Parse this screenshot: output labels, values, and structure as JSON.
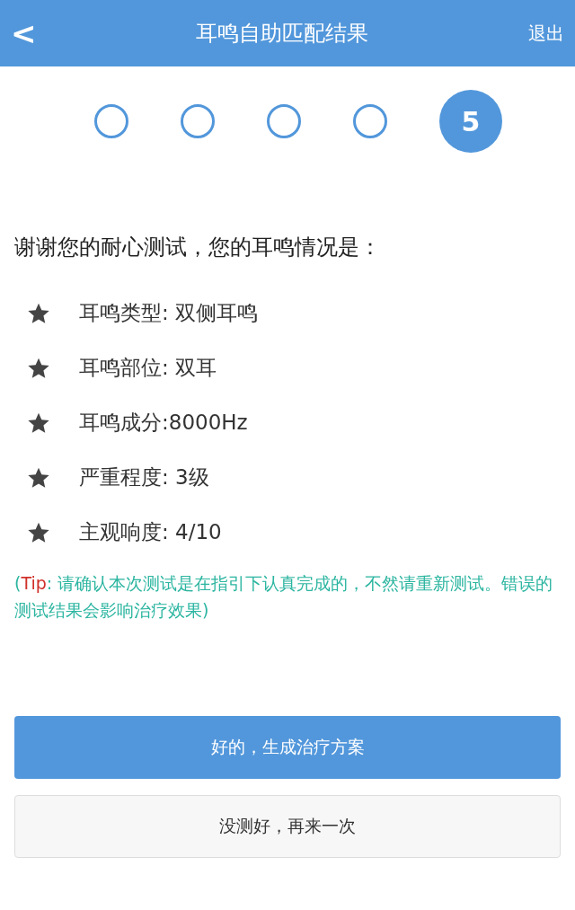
{
  "header": {
    "back": "<",
    "title": "耳鸣自助匹配结果",
    "exit": "退出"
  },
  "steps": [
    {
      "selected": false
    },
    {
      "selected": false
    },
    {
      "selected": false
    },
    {
      "selected": false
    },
    {
      "selected": true,
      "label": "5"
    }
  ],
  "intro": "谢谢您的耐心测试，您的耳鸣情况是：",
  "results": [
    "耳鸣类型: 双侧耳鸣",
    "耳鸣部位: 双耳",
    "耳鸣成分:8000Hz",
    "严重程度: 3级",
    "主观响度: 4/10"
  ],
  "tip": {
    "open": "(",
    "label": "Tip",
    "text": ": 请确认本次测试是在指引下认真完成的，不然请重新测试。错误的测试结果会影响治疗效果)"
  },
  "buttons": [
    {
      "kind": "primary",
      "label": "好的，生成治疗方案"
    },
    {
      "kind": "secondary",
      "label": "没测好，再来一次"
    }
  ]
}
